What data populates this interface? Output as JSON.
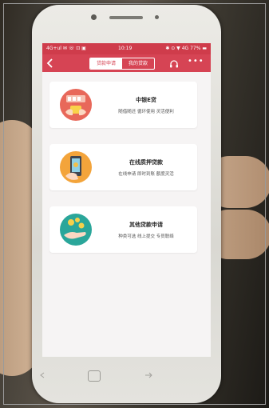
{
  "status_bar": {
    "left": "4G+ul ✉ ☏ ⊡ ▣",
    "time": "10:19",
    "right": "✱ ⊙ ▼ 4G 77% ▬"
  },
  "header": {
    "tabs": [
      {
        "label": "贷款申请",
        "active": true
      },
      {
        "label": "我的贷款",
        "active": false
      }
    ],
    "more_label": "•••"
  },
  "cards": [
    {
      "title": "中银E贷",
      "subtitle": "随借随还  循环使用  灵活便利",
      "icon": "hands-with-cards-icon"
    },
    {
      "title": "在线质押贷款",
      "subtitle": "在线申请  即时到账  额度灵活",
      "icon": "phone-payment-icon"
    },
    {
      "title": "其他贷款申请",
      "subtitle": "种类可选  线上提交  专员联络",
      "icon": "coins-hand-icon"
    }
  ],
  "colors": {
    "brand_red": "#d64454",
    "card1_icon": "#e8685a",
    "card2_icon": "#f3a43b",
    "card3_icon": "#2aa69a"
  }
}
